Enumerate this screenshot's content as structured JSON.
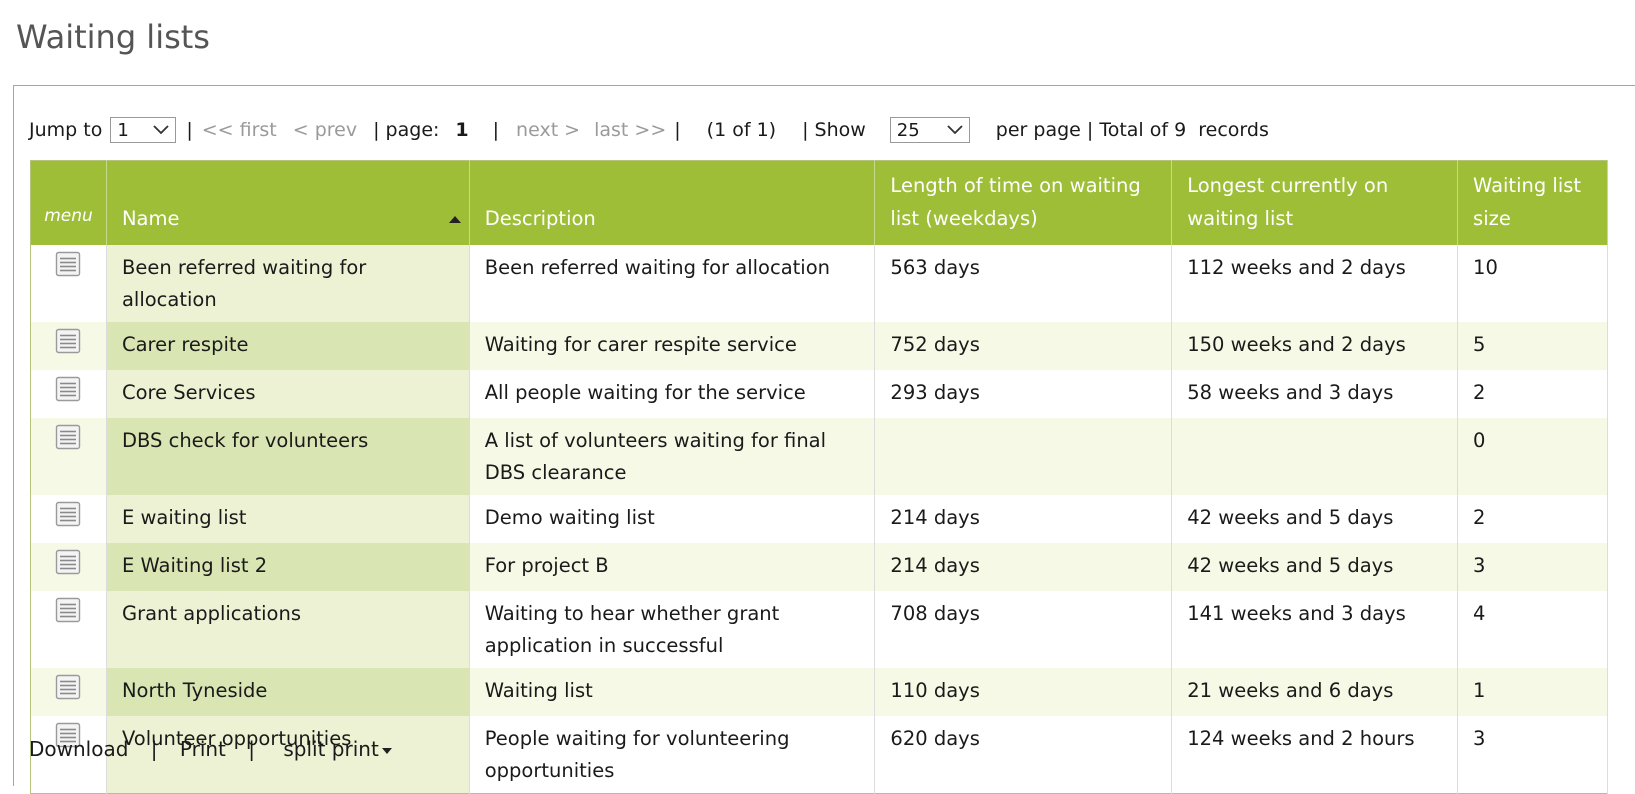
{
  "page": {
    "title": "Waiting lists"
  },
  "pager": {
    "jump_to_label": "Jump to",
    "jump_value": "1",
    "sep": "|",
    "first": "<< first",
    "prev": "< prev",
    "page_label": "| page:",
    "page_number": "1",
    "next": "next >",
    "last": "last >>",
    "range": "(1 of 1)",
    "show_label": "| Show",
    "per_page_value": "25",
    "per_page_label": "per page | Total of 9  records"
  },
  "table": {
    "headers": {
      "menu": "menu",
      "name": "Name",
      "description": "Description",
      "length_line1": "Length of time on waiting",
      "length_line2": "list (weekdays)",
      "longest_line1": "Longest currently on",
      "longest_line2": "waiting list",
      "size_line1": "Waiting list",
      "size_line2": "size"
    },
    "rows": [
      {
        "name": "Been referred waiting for allocation",
        "description": "Been referred waiting for allocation",
        "length": "563 days",
        "longest": "112 weeks and 2 days",
        "size": "10"
      },
      {
        "name": "Carer respite",
        "description": "Waiting for carer respite service",
        "length": "752 days",
        "longest": "150 weeks and 2 days",
        "size": "5"
      },
      {
        "name": "Core Services",
        "description": "All people waiting for the service",
        "length": "293 days",
        "longest": "58 weeks and 3 days",
        "size": "2"
      },
      {
        "name": "DBS check for volunteers",
        "description": "A list of volunteers waiting for final DBS clearance",
        "length": "",
        "longest": "",
        "size": "0"
      },
      {
        "name": "E waiting list",
        "description": "Demo waiting list",
        "length": "214 days",
        "longest": "42 weeks and 5 days",
        "size": "2"
      },
      {
        "name": "E Waiting list 2",
        "description": "For project B",
        "length": "214 days",
        "longest": "42 weeks and 5 days",
        "size": "3"
      },
      {
        "name": "Grant applications",
        "description": "Waiting to hear whether grant application in successful",
        "length": "708 days",
        "longest": "141 weeks and 3 days",
        "size": "4"
      },
      {
        "name": "North Tyneside",
        "description": "Waiting list",
        "length": "110 days",
        "longest": "21 weeks and 6 days",
        "size": "1"
      },
      {
        "name": "Volunteer opportunities",
        "description": "People waiting for volunteering opportunities",
        "length": "620 days",
        "longest": "124 weeks and 2 hours",
        "size": "3"
      }
    ]
  },
  "footer": {
    "download": "Download",
    "print": "Print",
    "split_print": "split print",
    "sep": "|"
  },
  "icons": {
    "row_menu": "list-menu-icon",
    "sort": "sort-ascending-icon",
    "dropdown": "chevron-down-icon"
  },
  "colors": {
    "header_bg": "#9fbe38",
    "name_col_odd": "#ecf2d3",
    "name_col_even": "#d9e5b3",
    "row_even": "#f6f9e6"
  }
}
